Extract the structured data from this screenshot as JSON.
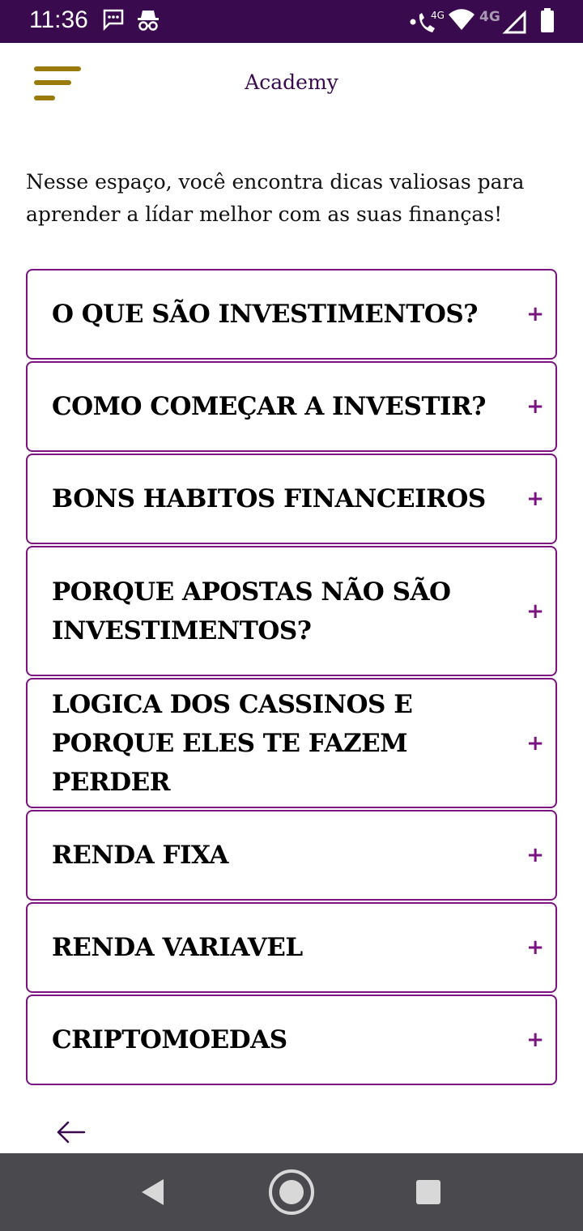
{
  "status_bar": {
    "time": "11:36",
    "network_label_1": "4G",
    "network_label_2": "4G"
  },
  "header": {
    "title": "Academy"
  },
  "intro": {
    "text": "Nesse espaço, você encontra dicas valiosas para aprender a lídar melhor com as suas finanças!"
  },
  "accordion": {
    "expand_symbol": "+",
    "items": [
      {
        "label": "O QUE SÃO INVESTIMENTOS?"
      },
      {
        "label": "COMO COMEÇAR A INVESTIR?"
      },
      {
        "label": "BONS HABITOS FINANCEIROS"
      },
      {
        "label": "PORQUE APOSTAS NÃO SÃO INVESTIMENTOS?"
      },
      {
        "label": "LOGICA DOS CASSINOS E PORQUE ELES TE FAZEM PERDER"
      },
      {
        "label": "RENDA FIXA"
      },
      {
        "label": "RENDA VARIAVEL"
      },
      {
        "label": "CRIPTOMOEDAS"
      }
    ]
  },
  "colors": {
    "status_bar": "#3a0a4f",
    "accent": "#7b1380",
    "title": "#3a0a4f",
    "menu_icon": "#9a7a0a",
    "nav_bar": "#4a4a4e"
  },
  "icons": {
    "menu": "menu-icon",
    "back": "arrow-left-icon",
    "nav_back": "triangle-back-icon",
    "nav_home": "circle-home-icon",
    "nav_recents": "square-recents-icon"
  }
}
